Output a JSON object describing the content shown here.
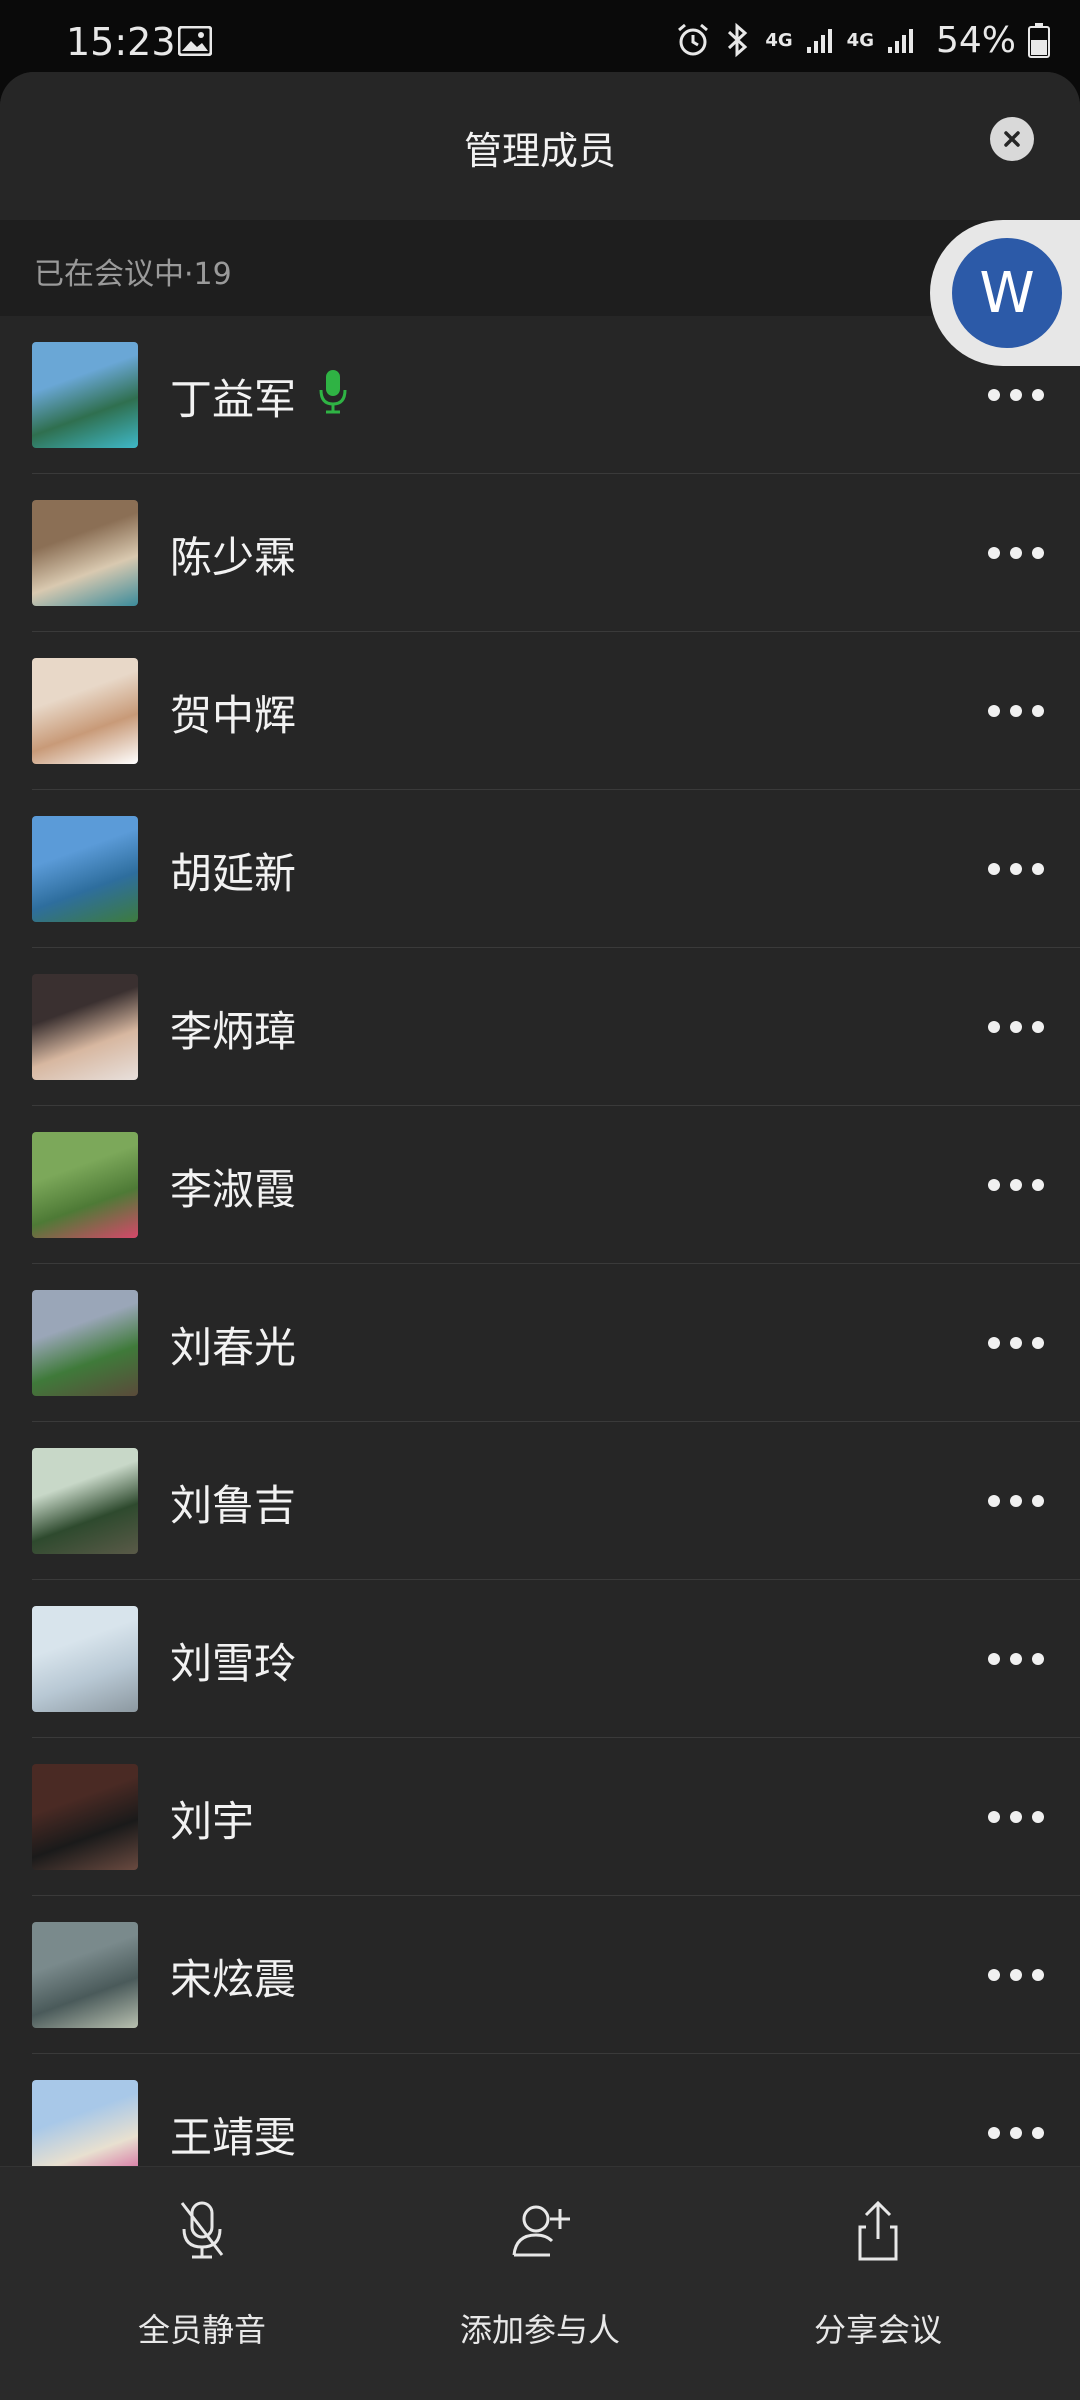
{
  "status_bar": {
    "time": "15:23",
    "battery": "54%",
    "network_1": "4G",
    "network_2": "4G"
  },
  "header": {
    "title": "管理成员"
  },
  "section": {
    "label": "已在会议中·19"
  },
  "floating_avatar": {
    "letter": "W",
    "color": "#2c5aa8"
  },
  "members": [
    {
      "name": "丁益军",
      "speaking": true,
      "avatar_colors": [
        "#6aa7d6",
        "#2f6f4f",
        "#3fb8c8"
      ]
    },
    {
      "name": "陈少霖",
      "speaking": false,
      "avatar_colors": [
        "#8b6f55",
        "#d9c9b0",
        "#3b8b9b"
      ]
    },
    {
      "name": "贺中辉",
      "speaking": false,
      "avatar_colors": [
        "#e8d8c8",
        "#c89a78",
        "#ffffff"
      ]
    },
    {
      "name": "胡延新",
      "speaking": false,
      "avatar_colors": [
        "#5b9bd8",
        "#2e6e9e",
        "#3d7b3d"
      ]
    },
    {
      "name": "李炳璋",
      "speaking": false,
      "avatar_colors": [
        "#3a3030",
        "#d7b7a0",
        "#e8e0dc"
      ]
    },
    {
      "name": "李淑霞",
      "speaking": false,
      "avatar_colors": [
        "#7ca85a",
        "#4e7a36",
        "#d6486a"
      ]
    },
    {
      "name": "刘春光",
      "speaking": false,
      "avatar_colors": [
        "#9aa6b8",
        "#3f7a3a",
        "#5a4a3a"
      ]
    },
    {
      "name": "刘鲁吉",
      "speaking": false,
      "avatar_colors": [
        "#c8d8c8",
        "#2e4a2e",
        "#5a5a48"
      ]
    },
    {
      "name": "刘雪玲",
      "speaking": false,
      "avatar_colors": [
        "#d8e4ec",
        "#b8c8d4",
        "#8c98a0"
      ]
    },
    {
      "name": "刘宇",
      "speaking": false,
      "avatar_colors": [
        "#4a2a24",
        "#1a1a1a",
        "#6a4a40"
      ]
    },
    {
      "name": "宋炫震",
      "speaking": false,
      "avatar_colors": [
        "#7a8a8c",
        "#4a5a5a",
        "#b8c0b0"
      ]
    },
    {
      "name": "王靖雯",
      "speaking": false,
      "avatar_colors": [
        "#a8c8e8",
        "#e8e0d0",
        "#d04890"
      ]
    }
  ],
  "bottom_bar": {
    "mute_all": "全员静音",
    "add_participant": "添加参与人",
    "share_meeting": "分享会议"
  },
  "colors": {
    "accent_speaking": "#2fb344",
    "sheet_bg": "#262626"
  }
}
